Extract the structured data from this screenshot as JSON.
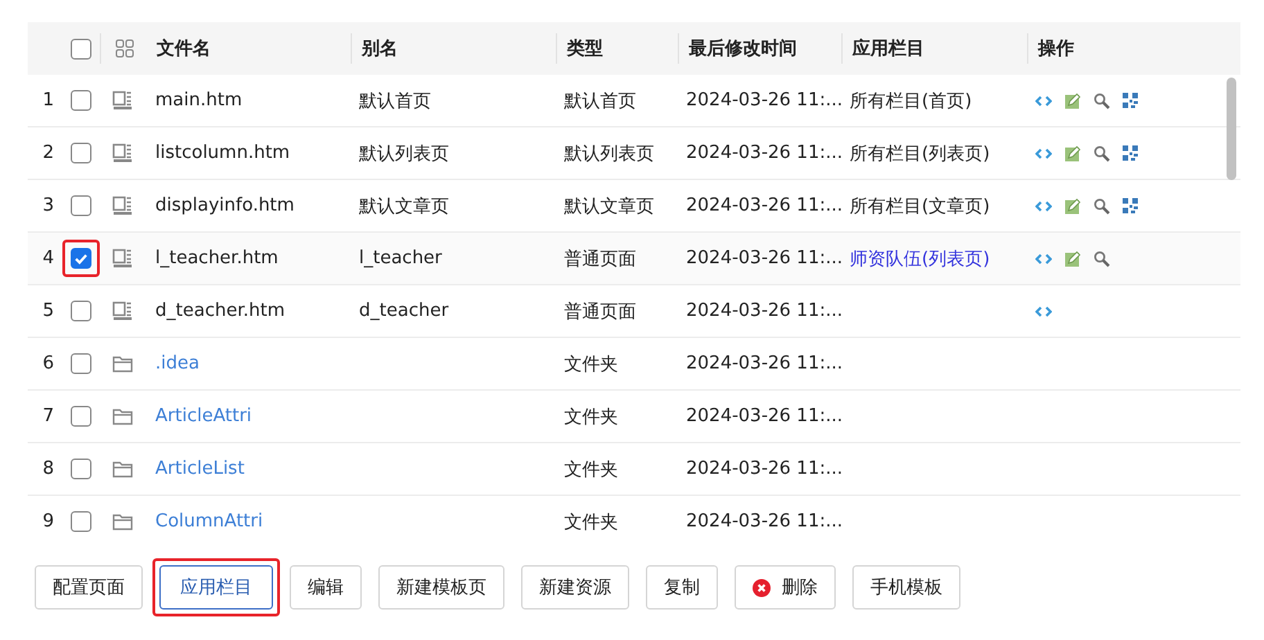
{
  "table": {
    "columns": [
      "文件名",
      "别名",
      "类型",
      "最后修改时间",
      "应用栏目",
      "操作"
    ],
    "all_checked": false,
    "rows": [
      {
        "index": "1",
        "kind": "file",
        "checked": false,
        "highlighted": false,
        "name": "main.htm",
        "alias": "默认首页",
        "type": "默认首页",
        "modified": "2024-03-26 11:...",
        "column": "所有栏目(首页)",
        "column_link": false,
        "actions": [
          {
            "kind": "code"
          },
          {
            "kind": "edit"
          },
          {
            "kind": "search"
          },
          {
            "kind": "qr"
          }
        ]
      },
      {
        "index": "2",
        "kind": "file",
        "checked": false,
        "highlighted": false,
        "name": "listcolumn.htm",
        "alias": "默认列表页",
        "type": "默认列表页",
        "modified": "2024-03-26 11:...",
        "column": "所有栏目(列表页)",
        "column_link": false,
        "actions": [
          {
            "kind": "code"
          },
          {
            "kind": "edit"
          },
          {
            "kind": "search"
          },
          {
            "kind": "qr"
          }
        ]
      },
      {
        "index": "3",
        "kind": "file",
        "checked": false,
        "highlighted": false,
        "name": "displayinfo.htm",
        "alias": "默认文章页",
        "type": "默认文章页",
        "modified": "2024-03-26 11:...",
        "column": "所有栏目(文章页)",
        "column_link": false,
        "actions": [
          {
            "kind": "code"
          },
          {
            "kind": "edit"
          },
          {
            "kind": "search"
          },
          {
            "kind": "qr"
          }
        ]
      },
      {
        "index": "4",
        "kind": "file",
        "checked": true,
        "highlighted": true,
        "name": "l_teacher.htm",
        "alias": "l_teacher",
        "type": "普通页面",
        "modified": "2024-03-26 11:...",
        "column": "师资队伍(列表页)",
        "column_link": true,
        "actions": [
          {
            "kind": "code"
          },
          {
            "kind": "edit"
          },
          {
            "kind": "search"
          }
        ]
      },
      {
        "index": "5",
        "kind": "file",
        "checked": false,
        "highlighted": false,
        "name": "d_teacher.htm",
        "alias": "d_teacher",
        "type": "普通页面",
        "modified": "2024-03-26 11:...",
        "actions": [
          {
            "kind": "code"
          }
        ]
      },
      {
        "index": "6",
        "kind": "folder",
        "checked": false,
        "highlighted": false,
        "name": ".idea",
        "type": "文件夹",
        "modified": "2024-03-26 11:..."
      },
      {
        "index": "7",
        "kind": "folder",
        "checked": false,
        "highlighted": false,
        "name": "ArticleAttri",
        "type": "文件夹",
        "modified": "2024-03-26 11:..."
      },
      {
        "index": "8",
        "kind": "folder",
        "checked": false,
        "highlighted": false,
        "name": "ArticleList",
        "type": "文件夹",
        "modified": "2024-03-26 11:..."
      },
      {
        "index": "9",
        "kind": "folder",
        "checked": false,
        "highlighted": false,
        "name": "ColumnAttri",
        "type": "文件夹",
        "modified": "2024-03-26 11:..."
      }
    ]
  },
  "buttons": [
    {
      "label": "配置页面",
      "kind": "plain",
      "highlighted": false
    },
    {
      "label": "应用栏目",
      "kind": "primary",
      "highlighted": true
    },
    {
      "label": "编辑",
      "kind": "plain",
      "highlighted": false
    },
    {
      "label": "新建模板页",
      "kind": "plain",
      "highlighted": false
    },
    {
      "label": "新建资源",
      "kind": "plain",
      "highlighted": false
    },
    {
      "label": "复制",
      "kind": "plain",
      "highlighted": false
    },
    {
      "label": "删除",
      "kind": "delete",
      "highlighted": false
    },
    {
      "label": "手机模板",
      "kind": "plain",
      "highlighted": false
    }
  ]
}
